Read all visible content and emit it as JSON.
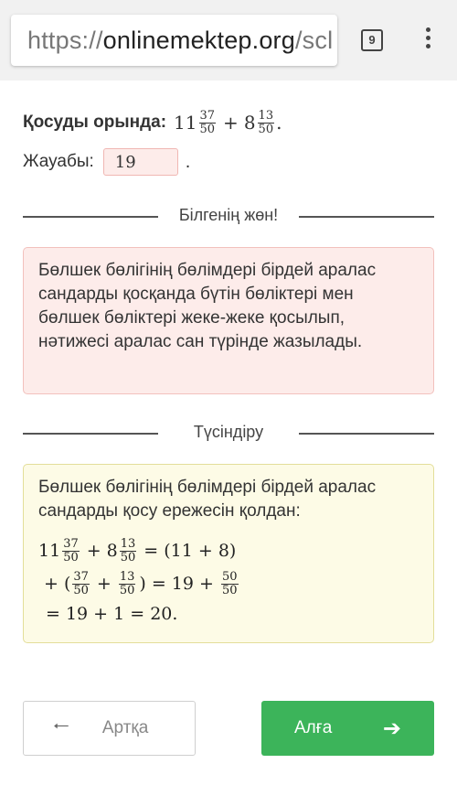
{
  "browser": {
    "url_scheme": "https://",
    "url_host": "onlinemektep.org",
    "url_path": "/scl",
    "tab_count": "9"
  },
  "task": {
    "label": "Қосуды орында:",
    "whole1": "11",
    "num1": "37",
    "den1": "50",
    "plus": "+",
    "whole2": "8",
    "num2": "13",
    "den2": "50",
    "end": "."
  },
  "answer": {
    "label": "Жауабы:",
    "value": "19",
    "end": "."
  },
  "info": {
    "heading": "Білгенің жөн!",
    "text": "Бөлшек бөлігінің бөлімдері бірдей аралас сандарды қосқанда бүтін бөліктері мен бөлшек бөліктері жеке-жеке қосылып, нәтижесі аралас сан түрінде жазылады."
  },
  "explanation": {
    "heading": "Түсіндіру",
    "text": "Бөлшек бөлігінің бөлімдері бірдей аралас сандарды қосу ережесін қолдан:",
    "line1_a": "11",
    "line1_an": "37",
    "line1_ad": "50",
    "line1_plus": "+",
    "line1_b": "8",
    "line1_bn": "13",
    "line1_bd": "50",
    "line1_rest": "= (11 + 8)",
    "line2_start": "+ (",
    "line2_an": "37",
    "line2_ad": "50",
    "line2_plus": "+",
    "line2_bn": "13",
    "line2_bd": "50",
    "line2_mid": ") = 19 +",
    "line2_cn": "50",
    "line2_cd": "50",
    "line3": "= 19 + 1 = 20."
  },
  "buttons": {
    "back": "Артқа",
    "next": "Алға"
  },
  "colors": {
    "next_button": "#3cb45a",
    "info_bg": "#fdecea",
    "explanation_bg": "#fdfbe6"
  }
}
